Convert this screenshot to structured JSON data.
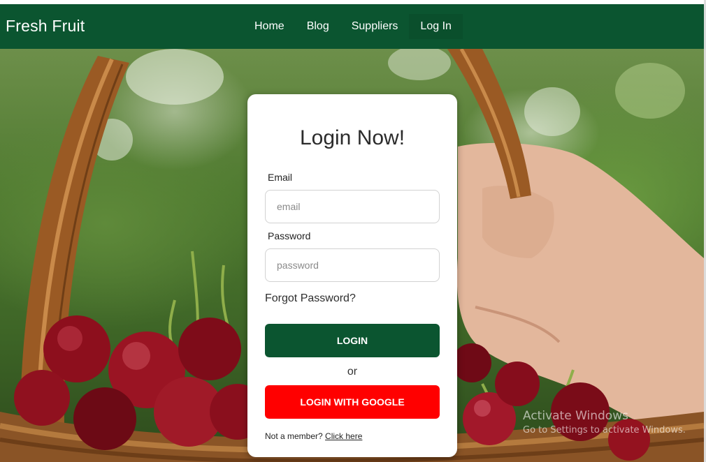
{
  "app": {
    "brand": "Fresh Fruit"
  },
  "nav": {
    "items": [
      {
        "label": "Home"
      },
      {
        "label": "Blog"
      },
      {
        "label": "Suppliers"
      },
      {
        "label": "Log In",
        "active": true
      }
    ]
  },
  "login": {
    "title": "Login Now!",
    "email_label": "Email",
    "email_placeholder": "email",
    "password_label": "Password",
    "password_placeholder": "password",
    "forgot": "Forgot Password?",
    "login_button": "LOGIN",
    "or": "or",
    "google_button": "LOGIN WITH GOOGLE",
    "member_text": "Not a member?",
    "member_link": "Click here"
  },
  "watermark": {
    "title": "Activate Windows",
    "subtitle": "Go to Settings to activate Windows."
  },
  "colors": {
    "primary": "#0b5530",
    "google": "#ff0000"
  },
  "icons": [
    "background-image"
  ]
}
